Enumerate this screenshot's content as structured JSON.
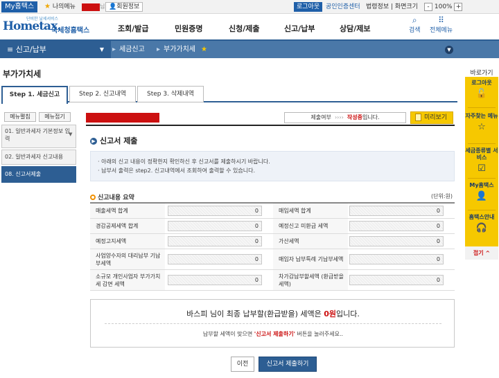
{
  "topbar": {
    "my_hometax": "My홈택스",
    "my_menu": "나의메뉴",
    "nim": "님",
    "member_info": "회원정보",
    "logout": "로그아웃",
    "cert_center": "공인인증센터",
    "util_links": "법령정보 | 화면크기",
    "zoom_minus": "-",
    "zoom_level": "100%",
    "zoom_plus": "+"
  },
  "header": {
    "logo_tag": "단비한 날세서비스",
    "logo_text": "Hometax.",
    "logo_kr": "국세청홈택스",
    "menu": [
      "조회/발급",
      "민원증명",
      "신청/제출",
      "신고/납부",
      "상담/제보"
    ],
    "search_label": "검색",
    "all_menu_label": "전체메뉴"
  },
  "navbar": {
    "current": "신고/납부",
    "crumb1": "세금신고",
    "crumb2": "부가가치세",
    "sep": "▸",
    "star": "★"
  },
  "page": {
    "title": "부가가치세"
  },
  "tabs": [
    {
      "label": "Step 1. 세금신고"
    },
    {
      "label": "Step 2. 신고내역"
    },
    {
      "label": "Step 3. 삭제내역"
    }
  ],
  "sidebar": {
    "expand": "메뉴펼침",
    "collapse": "메뉴접기",
    "steps": [
      {
        "label": "01. 일반과세자 기본정보 입력"
      },
      {
        "label": "02. 일반과세자 신고내용"
      },
      {
        "label": "08. 신고서제출"
      }
    ]
  },
  "status": {
    "label": "제출여부",
    "arrows": "››››",
    "value": "작성중",
    "suffix": "입니다.",
    "preview": "미리보기"
  },
  "section": {
    "title": "신고서 제출",
    "info": [
      "· 아래의 신고 내용이 정확한지 확인하신 후 신고서를 제출하시기 바랍니다.",
      "· 납부서 출력은 step2. 신고내역에서 조회하여 출력할 수 있습니다."
    ]
  },
  "summary": {
    "title": "신고내용 요약",
    "unit": "(단위:원)",
    "rows": [
      {
        "l1": "매출세액 합계",
        "v1": "0",
        "l2": "매입세액 합계",
        "v2": "0"
      },
      {
        "l1": "경감공제세액 합계",
        "v1": "0",
        "l2": "예정신고 미환급 세액",
        "v2": "0"
      },
      {
        "l1": "예정고지세액",
        "v1": "0",
        "l2": "가산세액",
        "v2": "0"
      },
      {
        "l1": "사업양수자의 대리납부 기납부세액",
        "v1": "0",
        "l2": "매입자 납부특례 기납부세액",
        "v2": "0"
      },
      {
        "l1": "소규모 개인사업자 부가가치세 감면 세액",
        "v1": "0",
        "l2": "차가감납부할세액 (환급받을세액)",
        "v2": "0"
      }
    ]
  },
  "result": {
    "line1_pre": "바스피 님이 최종 납부할(환급받을) 세액은 ",
    "line1_amount": "0원",
    "line1_post": "입니다.",
    "line2_pre": "납부할 세액이 맞으면 ",
    "line2_highlight": "'신고서 제출하기'",
    "line2_post": " 버튼을 눌러주세요.."
  },
  "buttons": {
    "prev": "이전",
    "submit": "신고서 제출하기"
  },
  "quick": {
    "title": "바로가기",
    "items": [
      {
        "label": "로그아웃",
        "icon": "unlock-icon"
      },
      {
        "label": "자주찾는 메뉴",
        "icon": "star-icon"
      },
      {
        "label": "세금종류별 서비스",
        "icon": "check-box-icon"
      },
      {
        "label": "My홈택스",
        "icon": "user-icon"
      },
      {
        "label": "홈택스안내",
        "icon": "headset-icon"
      }
    ],
    "close": "접기 ^"
  },
  "colors": {
    "primary": "#2d5e93",
    "nav": "#4a78a8",
    "accent": "#f6c800",
    "alert": "#cc1010"
  }
}
